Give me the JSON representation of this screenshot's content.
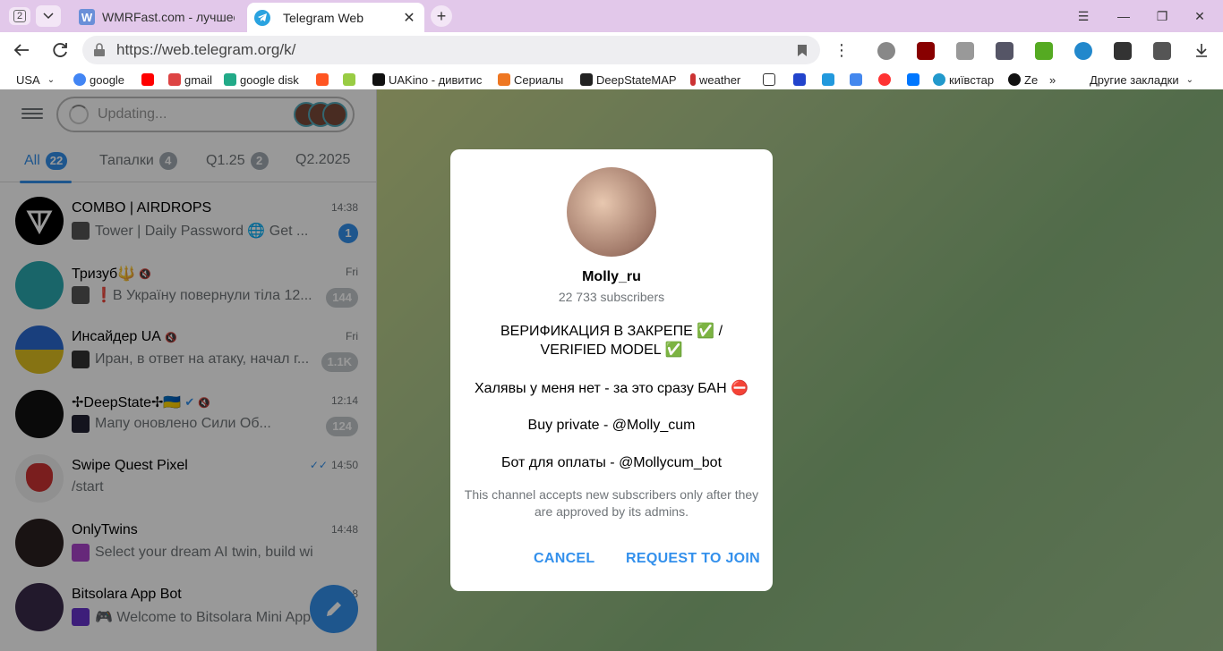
{
  "browser": {
    "tab_count": "2",
    "tabs": [
      {
        "title": "WMRFast.com - лучшее м"
      },
      {
        "title": "Telegram Web"
      }
    ],
    "url": "https://web.telegram.org/k/",
    "bookmarks": [
      "USA",
      "google",
      "gmail",
      "google disk",
      "UAKino - дивитис",
      "Сериалы",
      "DeepStateMAP",
      "weather",
      "київстар",
      "Ze",
      "Другие закладки"
    ]
  },
  "sidebar": {
    "search_placeholder": "Updating...",
    "folders": [
      {
        "label": "All",
        "count": "22"
      },
      {
        "label": "Тапалки",
        "count": "4"
      },
      {
        "label": "Q1.25",
        "count": "2"
      },
      {
        "label": "Q2.2025",
        "count": ""
      }
    ],
    "chats": [
      {
        "name": "COMBO | AIRDROPS",
        "time": "14:38",
        "message": "Tower | Daily Password 🌐 Get ...",
        "badge": "1"
      },
      {
        "name": "Тризуб🔱",
        "time": "Fri",
        "message": "❗️В Україну повернули тіла 12...",
        "badge": "144"
      },
      {
        "name": "Инсайдер UA",
        "time": "Fri",
        "message": "Иран, в ответ на атаку, начал г...",
        "badge": "1.1K"
      },
      {
        "name": "✢DeepState✢🇺🇦",
        "time": "12:14",
        "message": "Мапу оновлено    Сили Об...",
        "badge": "124"
      },
      {
        "name": "Swipe Quest Pixel",
        "time": "14:50",
        "message": "/start",
        "badge": ""
      },
      {
        "name": "OnlyTwins",
        "time": "14:48",
        "message": "Select your dream AI twin, build wild sto...",
        "badge": ""
      },
      {
        "name": "Bitsolara App Bot",
        "time": "8",
        "message": "🎮 Welcome to Bitsolara Mini App",
        "badge": ""
      }
    ]
  },
  "modal": {
    "name": "Molly_ru",
    "subscribers": "22 733 subscribers",
    "desc1": "ВЕРИФИКАЦИЯ В ЗАКРЕПЕ ✅ / VERIFIED MODEL ✅",
    "desc2": "Халявы у меня нет - за это сразу БАН ⛔",
    "desc3": "Buy private - @Molly_cum",
    "desc4": "Бот для оплаты - @Mollycum_bot",
    "note": "This channel accepts new subscribers only after they are approved by its admins.",
    "cancel": "CANCEL",
    "request": "REQUEST TO JOIN"
  }
}
